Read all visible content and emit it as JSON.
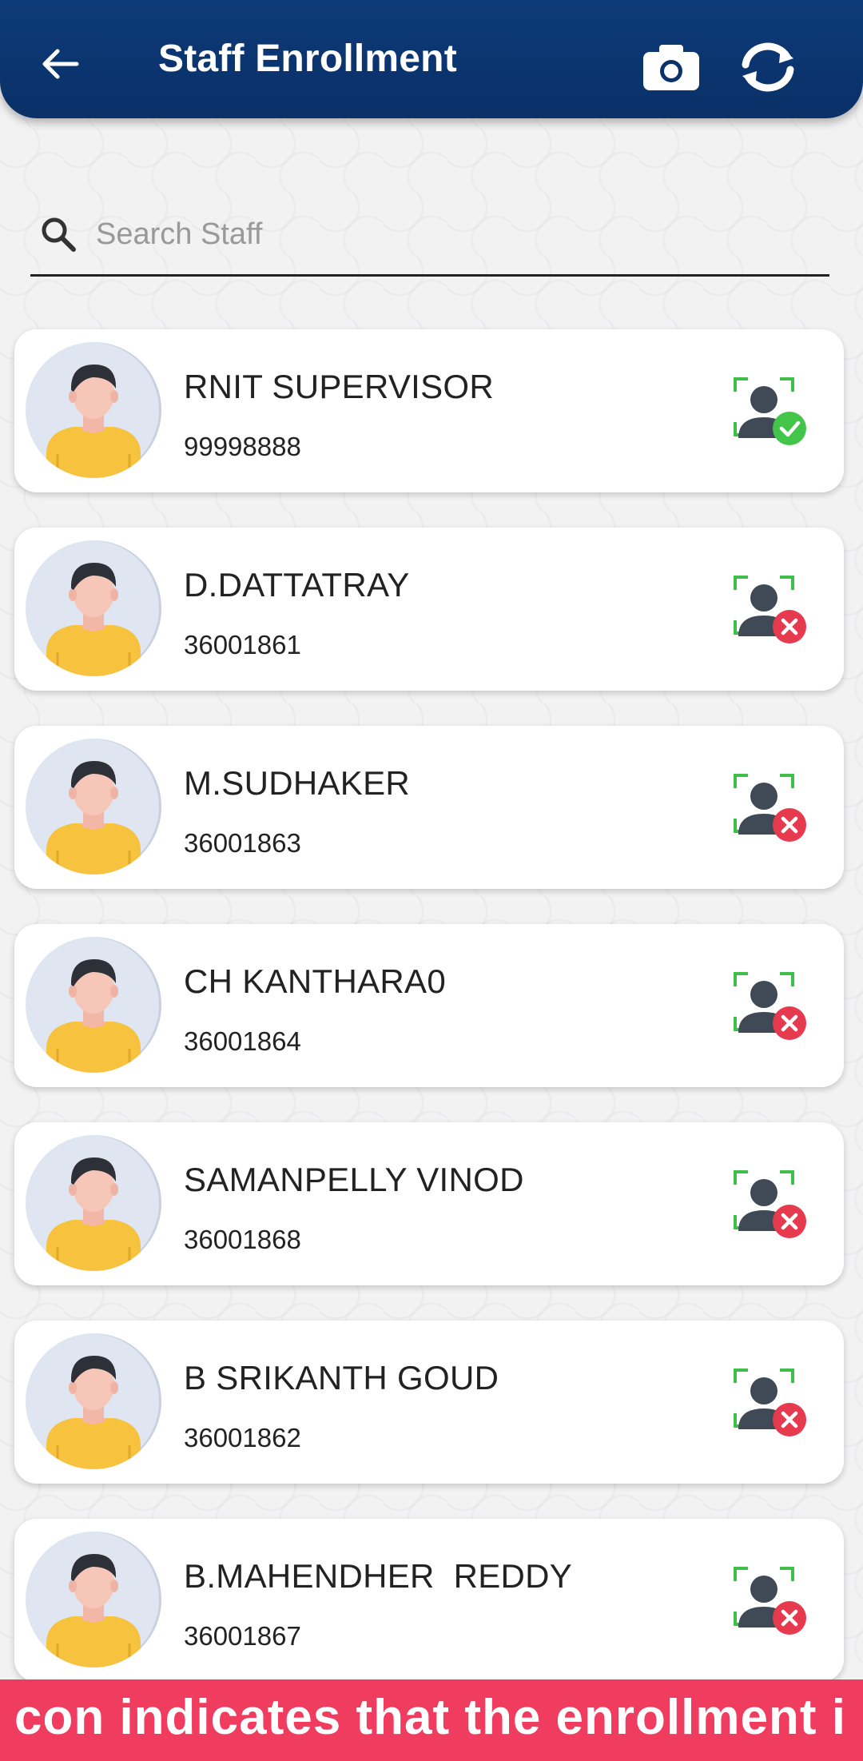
{
  "header": {
    "title": "Staff Enrollment",
    "back_icon": "arrow-left-icon",
    "camera_icon": "camera-icon",
    "sync_icon": "sync-icon"
  },
  "search": {
    "placeholder": "Search Staff",
    "value": ""
  },
  "colors": {
    "header": "#0a3168",
    "enrolled": "#43c54a",
    "not_enrolled": "#e63a4f",
    "banner": "#f03c5f"
  },
  "staff": [
    {
      "name": "RNIT SUPERVISOR",
      "id": "99998888",
      "enrolled": true
    },
    {
      "name": "D.DATTATRAY",
      "id": "36001861",
      "enrolled": false
    },
    {
      "name": "M.SUDHAKER",
      "id": "36001863",
      "enrolled": false
    },
    {
      "name": "CH KANTHARA0",
      "id": "36001864",
      "enrolled": false
    },
    {
      "name": "SAMANPELLY VINOD",
      "id": "36001868",
      "enrolled": false
    },
    {
      "name": "B SRIKANTH GOUD",
      "id": "36001862",
      "enrolled": false
    },
    {
      "name": "B.MAHENDHER  REDDY",
      "id": "36001867",
      "enrolled": false
    }
  ],
  "banner": {
    "text": "con indicates that the enrollment i"
  }
}
